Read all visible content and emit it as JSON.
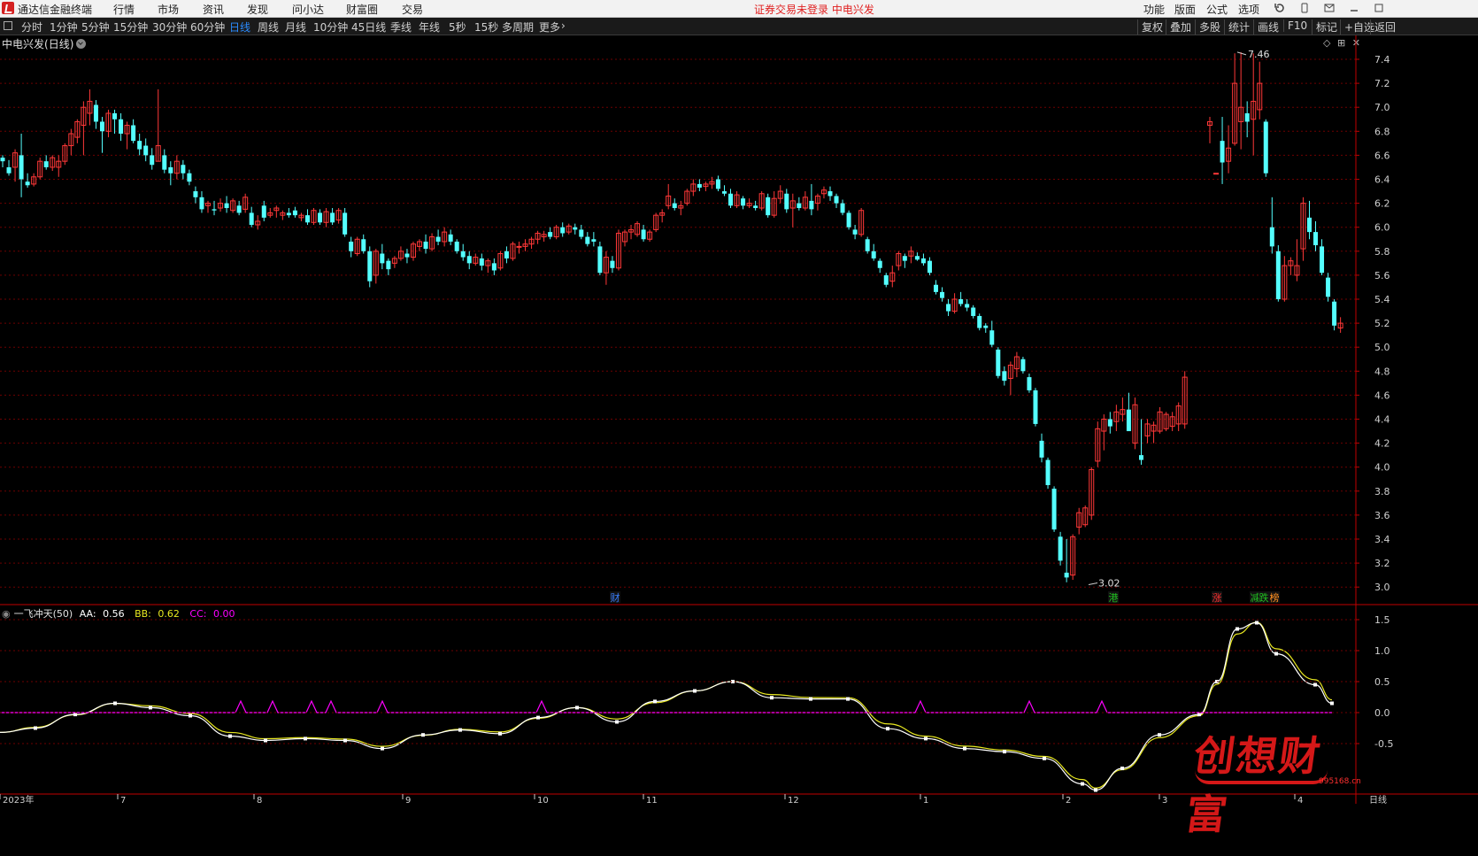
{
  "titlebar": {
    "app_name": "通达信金融终端",
    "menus": [
      "行情",
      "市场",
      "资讯",
      "发现",
      "问小达",
      "财富圈",
      "交易"
    ],
    "status": "证券交易未登录   中电兴发",
    "right_menus": [
      "功能",
      "版面",
      "公式",
      "选项"
    ]
  },
  "periods": [
    "分时",
    "1分钟",
    "5分钟",
    "15分钟",
    "30分钟",
    "60分钟",
    "日线",
    "周线",
    "月线",
    "10分钟",
    "45日线",
    "季线",
    "年线",
    "5秒",
    "15秒",
    "多周期",
    "更多"
  ],
  "active_period": "日线",
  "right_tools": [
    "复权",
    "叠加",
    "多股",
    "统计",
    "画线",
    "F10",
    "标记",
    "+自选",
    "返回"
  ],
  "stock": {
    "name": "中电兴发",
    "period_label": "(日线)"
  },
  "price_axis": {
    "ticks": [
      "7.4",
      "7.2",
      "7.0",
      "6.8",
      "6.6",
      "6.4",
      "6.2",
      "6.0",
      "5.8",
      "5.6",
      "5.4",
      "5.2",
      "5.0",
      "4.8",
      "4.6",
      "4.4",
      "4.2",
      "4.0",
      "3.8",
      "3.6",
      "3.4",
      "3.2",
      "3.0"
    ],
    "max_label": "7.46",
    "min_label": "3.02"
  },
  "event_tags": [
    {
      "text": "财",
      "color": "#3a7fff"
    },
    {
      "text": "港",
      "color": "#20c020"
    },
    {
      "text": "涨",
      "color": "#ff3030"
    },
    {
      "text": "减",
      "color": "#20c020"
    },
    {
      "text": "跌",
      "color": "#20c020"
    },
    {
      "text": "榜",
      "color": "#ff9020"
    }
  ],
  "indicator": {
    "name": "一飞冲天(50)",
    "aa_label": "AA:",
    "aa_value": "0.56",
    "bb_label": "BB:",
    "bb_value": "0.62",
    "cc_label": "CC:",
    "cc_value": "0.00",
    "axis_ticks": [
      "1.5",
      "1.0",
      "0.5",
      "0.0",
      "-0.5"
    ]
  },
  "date_axis": [
    "2023年",
    "7",
    "8",
    "9",
    "10",
    "11",
    "12",
    "1",
    "2",
    "3",
    "4"
  ],
  "bottom_right_label": "日线",
  "watermark": {
    "text": "创想财富",
    "url": "995168.cn"
  },
  "colors": {
    "up": "#ff3838",
    "down": "#54ffff",
    "grid": "#6e0000",
    "axis": "#c00000",
    "aa_line": "#ffffff",
    "bb_line": "#e8e820",
    "cc_line": "#ff00ff"
  },
  "chart_data": {
    "type": "candlestick",
    "price_range": [
      3.0,
      7.46
    ],
    "candles": [
      [
        6.58,
        6.6,
        6.5,
        6.55
      ],
      [
        6.5,
        6.56,
        6.43,
        6.45
      ],
      [
        6.5,
        6.65,
        6.38,
        6.62
      ],
      [
        6.6,
        6.78,
        6.25,
        6.4
      ],
      [
        6.38,
        6.45,
        6.33,
        6.35
      ],
      [
        6.36,
        6.45,
        6.34,
        6.42
      ],
      [
        6.42,
        6.58,
        6.4,
        6.55
      ],
      [
        6.55,
        6.6,
        6.48,
        6.5
      ],
      [
        6.5,
        6.6,
        6.47,
        6.58
      ],
      [
        6.5,
        6.6,
        6.42,
        6.55
      ],
      [
        6.55,
        6.7,
        6.52,
        6.68
      ],
      [
        6.68,
        6.82,
        6.6,
        6.78
      ],
      [
        6.75,
        6.9,
        6.7,
        6.88
      ],
      [
        6.85,
        7.05,
        6.6,
        7.0
      ],
      [
        6.95,
        7.15,
        6.85,
        7.05
      ],
      [
        7.02,
        7.06,
        6.82,
        6.88
      ],
      [
        6.88,
        6.92,
        6.62,
        6.8
      ],
      [
        6.8,
        6.98,
        6.75,
        6.95
      ],
      [
        6.95,
        6.98,
        6.78,
        6.9
      ],
      [
        6.9,
        6.95,
        6.72,
        6.78
      ],
      [
        6.78,
        6.88,
        6.65,
        6.85
      ],
      [
        6.85,
        6.9,
        6.7,
        6.72
      ],
      [
        6.72,
        6.78,
        6.6,
        6.65
      ],
      [
        6.68,
        6.74,
        6.55,
        6.6
      ],
      [
        6.6,
        6.66,
        6.48,
        6.52
      ],
      [
        6.55,
        7.15,
        6.55,
        6.68
      ],
      [
        6.6,
        6.65,
        6.45,
        6.48
      ],
      [
        6.5,
        6.55,
        6.35,
        6.45
      ],
      [
        6.45,
        6.6,
        6.4,
        6.55
      ],
      [
        6.52,
        6.56,
        6.4,
        6.45
      ],
      [
        6.45,
        6.48,
        6.35,
        6.38
      ],
      [
        6.3,
        6.34,
        6.2,
        6.25
      ],
      [
        6.25,
        6.3,
        6.12,
        6.15
      ],
      [
        6.18,
        6.22,
        6.12,
        6.2
      ],
      [
        6.15,
        6.22,
        6.1,
        6.14
      ],
      [
        6.16,
        6.24,
        6.13,
        6.2
      ],
      [
        6.2,
        6.26,
        6.12,
        6.16
      ],
      [
        6.14,
        6.24,
        6.12,
        6.22
      ],
      [
        6.18,
        6.22,
        6.1,
        6.12
      ],
      [
        6.15,
        6.28,
        6.12,
        6.25
      ],
      [
        6.12,
        6.17,
        6.0,
        6.02
      ],
      [
        6.02,
        6.1,
        5.98,
        6.05
      ],
      [
        6.18,
        6.22,
        6.05,
        6.08
      ],
      [
        6.1,
        6.16,
        6.08,
        6.12
      ],
      [
        6.14,
        6.18,
        6.08,
        6.16
      ],
      [
        6.1,
        6.14,
        6.06,
        6.12
      ],
      [
        6.12,
        6.16,
        6.08,
        6.1
      ],
      [
        6.14,
        6.17,
        6.08,
        6.1
      ],
      [
        6.08,
        6.12,
        6.05,
        6.1
      ],
      [
        6.1,
        6.15,
        6.02,
        6.04
      ],
      [
        6.04,
        6.16,
        6.02,
        6.14
      ],
      [
        6.12,
        6.15,
        6.02,
        6.04
      ],
      [
        6.04,
        6.16,
        6.0,
        6.13
      ],
      [
        6.12,
        6.16,
        6.02,
        6.04
      ],
      [
        6.06,
        6.16,
        6.03,
        6.14
      ],
      [
        6.12,
        6.16,
        5.92,
        5.94
      ],
      [
        5.88,
        5.92,
        5.75,
        5.8
      ],
      [
        5.78,
        5.92,
        5.76,
        5.9
      ],
      [
        5.9,
        5.94,
        5.78,
        5.8
      ],
      [
        5.8,
        5.84,
        5.5,
        5.55
      ],
      [
        5.6,
        5.82,
        5.53,
        5.8
      ],
      [
        5.78,
        5.86,
        5.65,
        5.7
      ],
      [
        5.72,
        5.74,
        5.6,
        5.65
      ],
      [
        5.7,
        5.76,
        5.66,
        5.74
      ],
      [
        5.74,
        5.84,
        5.72,
        5.8
      ],
      [
        5.78,
        5.82,
        5.7,
        5.75
      ],
      [
        5.75,
        5.88,
        5.72,
        5.86
      ],
      [
        5.84,
        5.9,
        5.8,
        5.88
      ],
      [
        5.88,
        5.94,
        5.78,
        5.82
      ],
      [
        5.82,
        5.95,
        5.8,
        5.92
      ],
      [
        5.92,
        5.98,
        5.85,
        5.88
      ],
      [
        5.88,
        6.0,
        5.84,
        5.96
      ],
      [
        5.94,
        5.98,
        5.85,
        5.88
      ],
      [
        5.88,
        5.9,
        5.78,
        5.8
      ],
      [
        5.8,
        5.86,
        5.72,
        5.75
      ],
      [
        5.76,
        5.8,
        5.65,
        5.7
      ],
      [
        5.7,
        5.78,
        5.68,
        5.75
      ],
      [
        5.74,
        5.78,
        5.64,
        5.68
      ],
      [
        5.68,
        5.74,
        5.62,
        5.72
      ],
      [
        5.7,
        5.74,
        5.6,
        5.64
      ],
      [
        5.66,
        5.8,
        5.64,
        5.78
      ],
      [
        5.8,
        5.84,
        5.7,
        5.74
      ],
      [
        5.74,
        5.88,
        5.72,
        5.86
      ],
      [
        5.84,
        5.88,
        5.78,
        5.84
      ],
      [
        5.84,
        5.9,
        5.8,
        5.86
      ],
      [
        5.86,
        5.92,
        5.82,
        5.9
      ],
      [
        5.9,
        5.97,
        5.86,
        5.95
      ],
      [
        5.92,
        5.97,
        5.88,
        5.94
      ],
      [
        5.96,
        6.0,
        5.9,
        5.92
      ],
      [
        5.92,
        6.02,
        5.9,
        6.0
      ],
      [
        6.0,
        6.04,
        5.92,
        5.95
      ],
      [
        5.96,
        6.03,
        5.94,
        6.01
      ],
      [
        6.0,
        6.03,
        5.94,
        5.98
      ],
      [
        5.98,
        6.02,
        5.9,
        5.92
      ],
      [
        5.92,
        5.96,
        5.84,
        5.86
      ],
      [
        5.9,
        5.96,
        5.84,
        5.88
      ],
      [
        5.84,
        5.88,
        5.6,
        5.62
      ],
      [
        5.62,
        5.8,
        5.52,
        5.75
      ],
      [
        5.72,
        5.76,
        5.62,
        5.66
      ],
      [
        5.66,
        5.98,
        5.64,
        5.95
      ],
      [
        5.88,
        5.98,
        5.84,
        5.96
      ],
      [
        5.96,
        6.02,
        5.9,
        5.98
      ],
      [
        5.94,
        6.05,
        5.92,
        6.03
      ],
      [
        5.98,
        6.02,
        5.88,
        5.9
      ],
      [
        5.9,
        5.98,
        5.88,
        5.96
      ],
      [
        5.98,
        6.12,
        5.96,
        6.1
      ],
      [
        6.1,
        6.15,
        6.04,
        6.12
      ],
      [
        6.18,
        6.36,
        6.15,
        6.26
      ],
      [
        6.2,
        6.24,
        6.14,
        6.16
      ],
      [
        6.16,
        6.22,
        6.1,
        6.18
      ],
      [
        6.2,
        6.32,
        6.18,
        6.3
      ],
      [
        6.3,
        6.4,
        6.26,
        6.36
      ],
      [
        6.36,
        6.4,
        6.3,
        6.33
      ],
      [
        6.34,
        6.38,
        6.3,
        6.36
      ],
      [
        6.36,
        6.42,
        6.32,
        6.38
      ],
      [
        6.4,
        6.43,
        6.3,
        6.32
      ],
      [
        6.3,
        6.35,
        6.26,
        6.28
      ],
      [
        6.28,
        6.32,
        6.16,
        6.18
      ],
      [
        6.18,
        6.3,
        6.16,
        6.27
      ],
      [
        6.24,
        6.26,
        6.15,
        6.18
      ],
      [
        6.18,
        6.24,
        6.16,
        6.2
      ],
      [
        6.18,
        6.22,
        6.14,
        6.16
      ],
      [
        6.16,
        6.3,
        6.14,
        6.28
      ],
      [
        6.25,
        6.28,
        6.08,
        6.1
      ],
      [
        6.1,
        6.3,
        6.08,
        6.24
      ],
      [
        6.24,
        6.35,
        6.2,
        6.3
      ],
      [
        6.28,
        6.32,
        6.12,
        6.15
      ],
      [
        6.16,
        6.28,
        6.0,
        6.22
      ],
      [
        6.2,
        6.25,
        6.14,
        6.16
      ],
      [
        6.16,
        6.3,
        6.14,
        6.25
      ],
      [
        6.22,
        6.36,
        6.1,
        6.15
      ],
      [
        6.2,
        6.28,
        6.14,
        6.26
      ],
      [
        6.28,
        6.34,
        6.24,
        6.31
      ],
      [
        6.3,
        6.34,
        6.22,
        6.26
      ],
      [
        6.26,
        6.28,
        6.16,
        6.2
      ],
      [
        6.2,
        6.23,
        6.1,
        6.12
      ],
      [
        6.12,
        6.14,
        5.98,
        6.0
      ],
      [
        5.98,
        6.02,
        5.9,
        5.94
      ],
      [
        5.94,
        6.16,
        5.92,
        6.14
      ],
      [
        5.9,
        5.92,
        5.78,
        5.8
      ],
      [
        5.8,
        5.86,
        5.72,
        5.74
      ],
      [
        5.72,
        5.74,
        5.62,
        5.66
      ],
      [
        5.6,
        5.62,
        5.5,
        5.52
      ],
      [
        5.55,
        5.68,
        5.5,
        5.62
      ],
      [
        5.68,
        5.8,
        5.64,
        5.78
      ],
      [
        5.76,
        5.78,
        5.66,
        5.72
      ],
      [
        5.76,
        5.84,
        5.7,
        5.8
      ],
      [
        5.76,
        5.79,
        5.72,
        5.73
      ],
      [
        5.74,
        5.78,
        5.68,
        5.7
      ],
      [
        5.72,
        5.75,
        5.6,
        5.62
      ],
      [
        5.52,
        5.56,
        5.44,
        5.46
      ],
      [
        5.46,
        5.5,
        5.38,
        5.41
      ],
      [
        5.36,
        5.4,
        5.26,
        5.3
      ],
      [
        5.3,
        5.45,
        5.28,
        5.4
      ],
      [
        5.4,
        5.46,
        5.34,
        5.36
      ],
      [
        5.36,
        5.4,
        5.3,
        5.33
      ],
      [
        5.33,
        5.35,
        5.24,
        5.26
      ],
      [
        5.26,
        5.28,
        5.14,
        5.16
      ],
      [
        5.18,
        5.2,
        5.12,
        5.16
      ],
      [
        5.14,
        5.22,
        5.0,
        5.02
      ],
      [
        4.98,
        5.0,
        4.74,
        4.76
      ],
      [
        4.8,
        4.84,
        4.68,
        4.72
      ],
      [
        4.74,
        4.88,
        4.6,
        4.85
      ],
      [
        4.82,
        4.96,
        4.75,
        4.92
      ],
      [
        4.9,
        4.92,
        4.78,
        4.8
      ],
      [
        4.75,
        4.78,
        4.62,
        4.64
      ],
      [
        4.64,
        4.66,
        4.34,
        4.36
      ],
      [
        4.22,
        4.28,
        4.04,
        4.08
      ],
      [
        4.06,
        4.08,
        3.82,
        3.85
      ],
      [
        3.82,
        3.84,
        3.46,
        3.48
      ],
      [
        3.42,
        3.46,
        3.18,
        3.22
      ],
      [
        3.12,
        3.4,
        3.04,
        3.08
      ],
      [
        3.1,
        3.44,
        3.06,
        3.42
      ],
      [
        3.5,
        3.66,
        3.44,
        3.62
      ],
      [
        3.52,
        3.68,
        3.5,
        3.66
      ],
      [
        3.6,
        4.0,
        3.56,
        3.98
      ],
      [
        4.05,
        4.38,
        4.0,
        4.32
      ],
      [
        4.3,
        4.44,
        4.14,
        4.4
      ],
      [
        4.4,
        4.46,
        4.28,
        4.34
      ],
      [
        4.38,
        4.52,
        4.3,
        4.46
      ],
      [
        4.44,
        4.58,
        4.38,
        4.48
      ],
      [
        4.48,
        4.62,
        4.42,
        4.3
      ],
      [
        4.2,
        4.58,
        4.15,
        4.52
      ],
      [
        4.1,
        4.4,
        4.02,
        4.06
      ],
      [
        4.26,
        4.4,
        4.2,
        4.36
      ],
      [
        4.3,
        4.38,
        4.2,
        4.35
      ],
      [
        4.3,
        4.5,
        4.28,
        4.46
      ],
      [
        4.32,
        4.46,
        4.3,
        4.44
      ],
      [
        4.34,
        4.46,
        4.3,
        4.42
      ],
      [
        4.36,
        4.54,
        4.3,
        4.51
      ],
      [
        4.36,
        4.8,
        4.32,
        4.75
      ],
      [
        6.85,
        6.92,
        6.7,
        6.88
      ],
      [
        6.45,
        6.45,
        6.45,
        6.45
      ],
      [
        6.72,
        6.92,
        6.36,
        6.54
      ],
      [
        6.55,
        6.85,
        6.45,
        6.66
      ],
      [
        6.7,
        7.45,
        6.68,
        7.2
      ],
      [
        6.88,
        7.46,
        6.65,
        7.0
      ],
      [
        6.95,
        7.05,
        6.75,
        6.88
      ],
      [
        6.9,
        7.45,
        6.6,
        7.05
      ],
      [
        6.98,
        7.38,
        6.9,
        7.2
      ],
      [
        6.88,
        6.9,
        6.42,
        6.45
      ],
      [
        6.0,
        6.25,
        5.78,
        5.84
      ],
      [
        5.8,
        5.85,
        5.38,
        5.4
      ],
      [
        5.4,
        5.76,
        5.38,
        5.68
      ],
      [
        5.68,
        5.75,
        5.6,
        5.72
      ],
      [
        5.6,
        5.9,
        5.55,
        5.68
      ],
      [
        5.82,
        6.25,
        5.72,
        6.2
      ],
      [
        6.08,
        6.22,
        5.9,
        5.96
      ],
      [
        5.96,
        6.05,
        5.8,
        5.85
      ],
      [
        5.84,
        5.9,
        5.6,
        5.62
      ],
      [
        5.58,
        5.62,
        5.38,
        5.42
      ],
      [
        5.38,
        5.4,
        5.14,
        5.18
      ],
      [
        5.16,
        5.25,
        5.12,
        5.2
      ]
    ]
  }
}
